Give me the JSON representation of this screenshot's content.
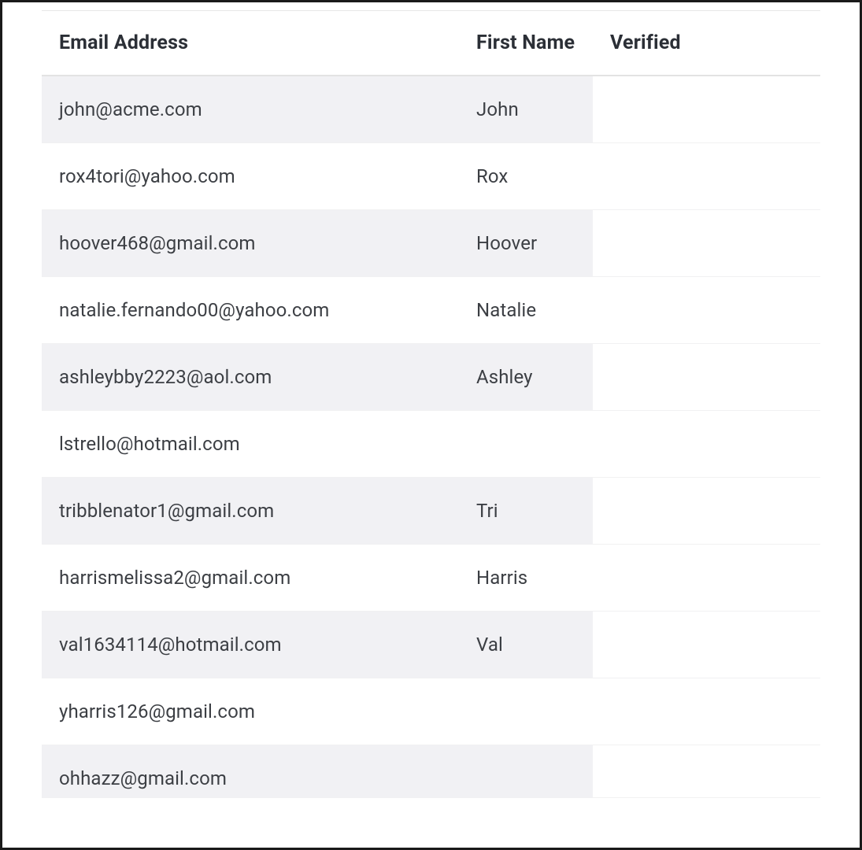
{
  "table": {
    "headers": {
      "email": "Email Address",
      "first_name": "First Name",
      "verified": "Verified"
    },
    "rows": [
      {
        "email": "john@acme.com",
        "first_name": "John",
        "verified": ""
      },
      {
        "email": "rox4tori@yahoo.com",
        "first_name": "Rox",
        "verified": ""
      },
      {
        "email": "hoover468@gmail.com",
        "first_name": "Hoover",
        "verified": ""
      },
      {
        "email": "natalie.fernando00@yahoo.com",
        "first_name": "Natalie",
        "verified": ""
      },
      {
        "email": "ashleybby2223@aol.com",
        "first_name": "Ashley",
        "verified": ""
      },
      {
        "email": "lstrello@hotmail.com",
        "first_name": "",
        "verified": ""
      },
      {
        "email": "tribblenator1@gmail.com",
        "first_name": "Tri",
        "verified": ""
      },
      {
        "email": "harrismelissa2@gmail.com",
        "first_name": "Harris",
        "verified": ""
      },
      {
        "email": "val1634114@hotmail.com",
        "first_name": "Val",
        "verified": ""
      },
      {
        "email": "yharris126@gmail.com",
        "first_name": "",
        "verified": ""
      },
      {
        "email": "ohhazz@gmail.com",
        "first_name": "",
        "verified": ""
      }
    ]
  }
}
